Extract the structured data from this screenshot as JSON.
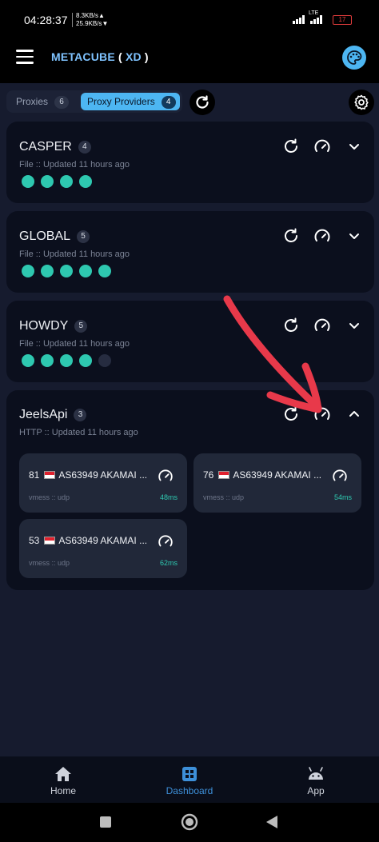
{
  "status_bar": {
    "time": "04:28:37",
    "speed_up": "8.3KB/s▲",
    "speed_down": "25.9KB/s▼",
    "network": "LTE",
    "battery": "17"
  },
  "header": {
    "title": "METACUBE",
    "title_suffix": "XD",
    "paren_open": "(",
    "paren_close": ")",
    "menu_icon": "hamburger-menu-icon",
    "theme_icon": "palette-icon"
  },
  "tabs": [
    {
      "label": "Proxies",
      "count": "6"
    },
    {
      "label": "Proxy Providers",
      "count": "4"
    }
  ],
  "providers": [
    {
      "name": "CASPER",
      "count": "4",
      "subtitle": "File :: Updated 11 hours ago",
      "dots": [
        true,
        true,
        true,
        true
      ],
      "expanded": false
    },
    {
      "name": "GLOBAL",
      "count": "5",
      "subtitle": "File :: Updated 11 hours ago",
      "dots": [
        true,
        true,
        true,
        true,
        true
      ],
      "expanded": false
    },
    {
      "name": "HOWDY",
      "count": "5",
      "subtitle": "File :: Updated 11 hours ago",
      "dots": [
        true,
        true,
        true,
        true,
        false
      ],
      "expanded": false
    },
    {
      "name": "JeelsApi",
      "count": "3",
      "subtitle": "HTTP :: Updated 11 hours ago",
      "expanded": true,
      "proxies": [
        {
          "name": "81 🇸🇬 AS63949 AKAMAI ...",
          "id": "81",
          "label": "AS63949 AKAMAI ...",
          "type": "vmess :: udp",
          "latency": "48ms"
        },
        {
          "name": "76 🇸🇬 AS63949 AKAMAI ...",
          "id": "76",
          "label": "AS63949 AKAMAI ...",
          "type": "vmess :: udp",
          "latency": "54ms"
        },
        {
          "name": "53 🇸🇬 AS63949 AKAMAI ...",
          "id": "53",
          "label": "AS63949 AKAMAI ...",
          "type": "vmess :: udp",
          "latency": "62ms"
        }
      ]
    }
  ],
  "bottom_nav": [
    {
      "label": "Home",
      "icon": "home-icon",
      "active": false
    },
    {
      "label": "Dashboard",
      "icon": "dashboard-icon",
      "active": true
    },
    {
      "label": "App",
      "icon": "android-icon",
      "active": false
    }
  ],
  "colors": {
    "accent": "#4db6f2",
    "status_online": "#2ec8b0",
    "latency": "#2ec8b0",
    "annotation_arrow": "#e8394a"
  }
}
